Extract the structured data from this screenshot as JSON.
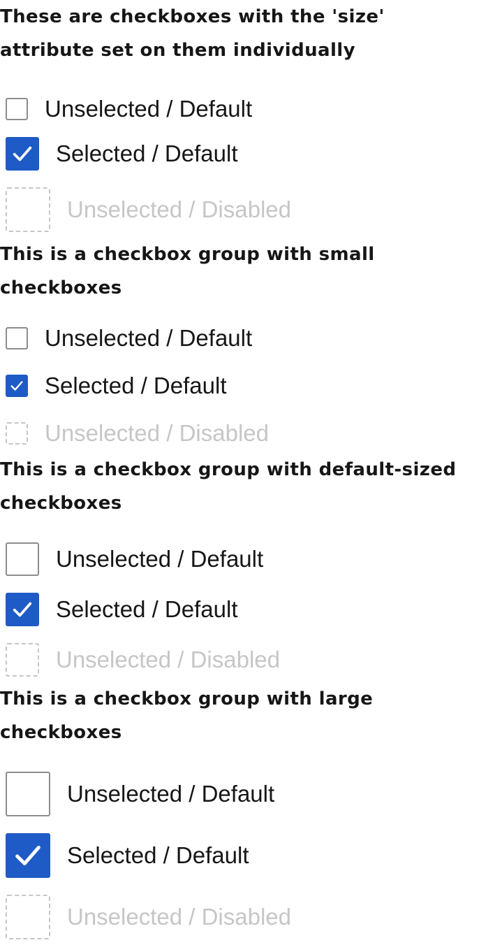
{
  "sections": [
    {
      "heading": "These are checkboxes with the 'size' attribute set on them individually",
      "items": [
        {
          "label": "Unselected / Default",
          "state": "unchecked",
          "size": "small"
        },
        {
          "label": "Selected / Default",
          "state": "checked",
          "size": "default"
        },
        {
          "label": "Unselected / Disabled",
          "state": "disabled",
          "size": "large"
        }
      ]
    },
    {
      "heading": "This is a checkbox group with small checkboxes",
      "items": [
        {
          "label": "Unselected / Default",
          "state": "unchecked",
          "size": "small"
        },
        {
          "label": "Selected / Default",
          "state": "checked",
          "size": "small"
        },
        {
          "label": "Unselected / Disabled",
          "state": "disabled",
          "size": "small"
        }
      ]
    },
    {
      "heading": "This is a checkbox group with default-sized checkboxes",
      "items": [
        {
          "label": "Unselected / Default",
          "state": "unchecked",
          "size": "default"
        },
        {
          "label": "Selected / Default",
          "state": "checked",
          "size": "default"
        },
        {
          "label": "Unselected / Disabled",
          "state": "disabled",
          "size": "default"
        }
      ]
    },
    {
      "heading": "This is a checkbox group with large checkboxes",
      "items": [
        {
          "label": "Unselected / Default",
          "state": "unchecked",
          "size": "large"
        },
        {
          "label": "Selected / Default",
          "state": "checked",
          "size": "large"
        },
        {
          "label": "Unselected / Disabled",
          "state": "disabled",
          "size": "large"
        }
      ]
    }
  ],
  "colors": {
    "checked": "#1f5bc6",
    "border": "#8d8d8d",
    "disabled": "#c6c6c6",
    "text": "#161616"
  },
  "icons": {
    "check": "checkmark-icon"
  }
}
